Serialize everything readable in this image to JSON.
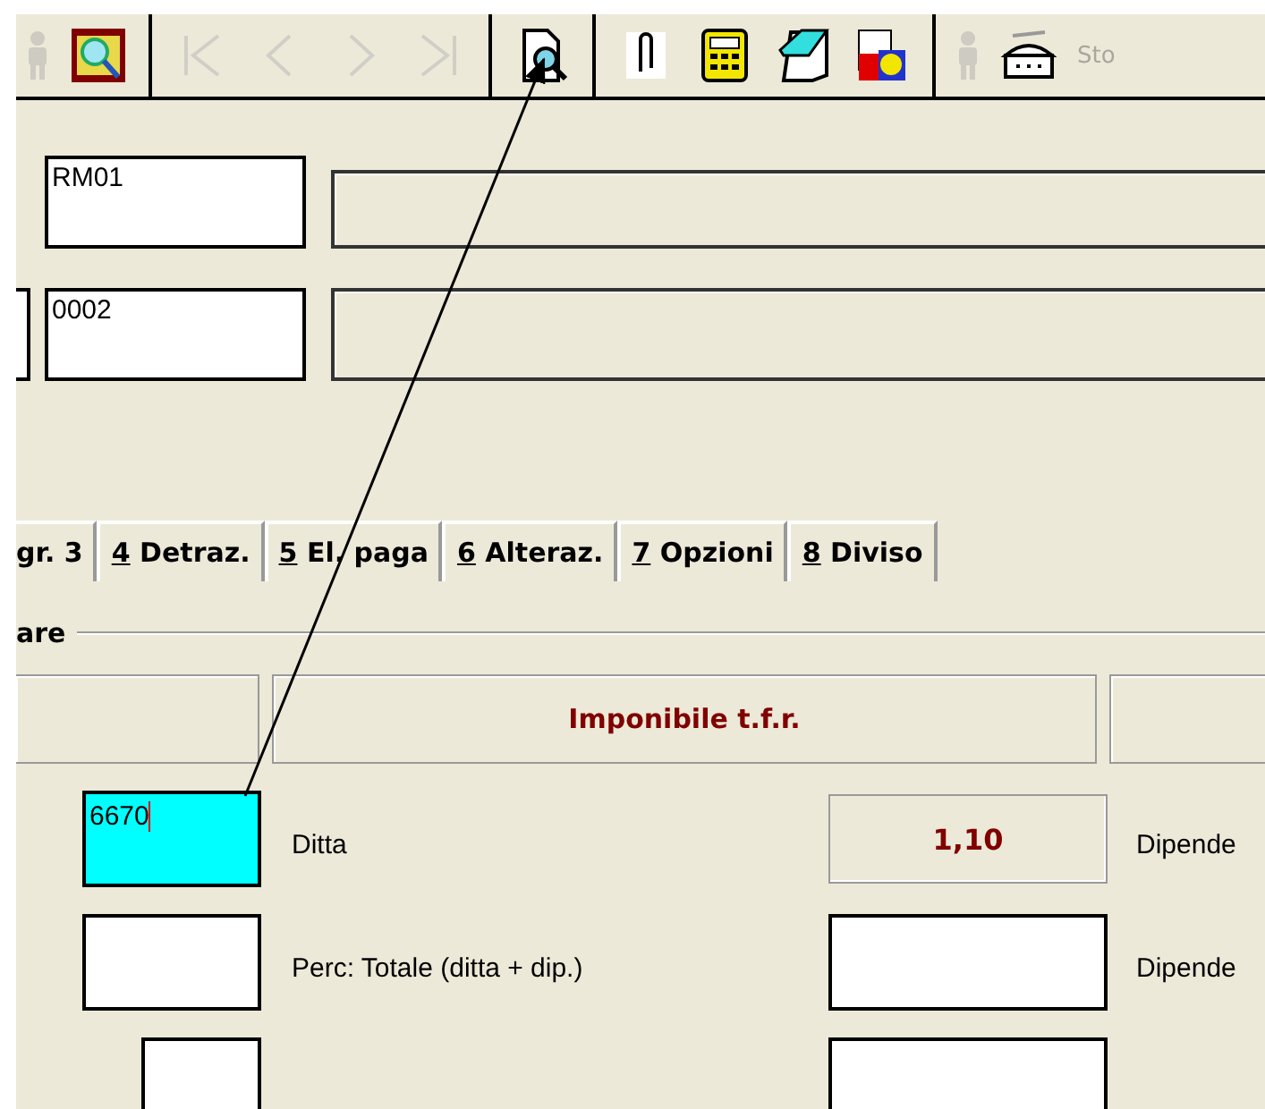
{
  "toolbar": [
    {
      "kind": "person",
      "disabled": true
    },
    {
      "kind": "folder-search",
      "disabled": false
    },
    {
      "kind": "separator"
    },
    {
      "kind": "first",
      "disabled": true
    },
    {
      "kind": "prev",
      "disabled": true
    },
    {
      "kind": "next",
      "disabled": true
    },
    {
      "kind": "last",
      "disabled": true
    },
    {
      "kind": "separator"
    },
    {
      "kind": "preview",
      "disabled": false
    },
    {
      "kind": "separator"
    },
    {
      "kind": "clip",
      "disabled": false
    },
    {
      "kind": "calc",
      "disabled": false
    },
    {
      "kind": "notepad",
      "disabled": false
    },
    {
      "kind": "docs",
      "disabled": false
    },
    {
      "kind": "separator"
    },
    {
      "kind": "person",
      "disabled": true
    },
    {
      "kind": "device",
      "disabled": false
    },
    {
      "kind": "text",
      "label": "Sto",
      "disabled": true
    }
  ],
  "fields": [
    {
      "value": "RM01",
      "left_stub": false
    },
    {
      "value": "0002",
      "left_stub": true
    }
  ],
  "tabs": [
    {
      "label": "gr. 3",
      "selected": false
    },
    {
      "accel": "4",
      "label": "Detraz.",
      "selected": false
    },
    {
      "accel": "5",
      "label": "El. paga",
      "selected": false
    },
    {
      "accel": "6",
      "label": "Alteraz.",
      "selected": false
    },
    {
      "accel": "7",
      "label": "Opzioni",
      "selected": false
    },
    {
      "accel": "8",
      "label": "Diviso",
      "selected": false
    }
  ],
  "group_title": "are",
  "header": {
    "title": "Imponibile t.f.r."
  },
  "rows": [
    {
      "input": "6670",
      "focused": true,
      "label": "Ditta",
      "value": "1,10",
      "readonly": true,
      "right_label": "Dipende"
    },
    {
      "input": "",
      "focused": false,
      "label": "Perc: Totale (ditta + dip.)",
      "value": "",
      "readonly": false,
      "right_label": "Dipende"
    },
    {
      "input": "",
      "focused": false,
      "label": "",
      "value": "",
      "readonly": false,
      "right_label": "",
      "indent": true
    }
  ]
}
